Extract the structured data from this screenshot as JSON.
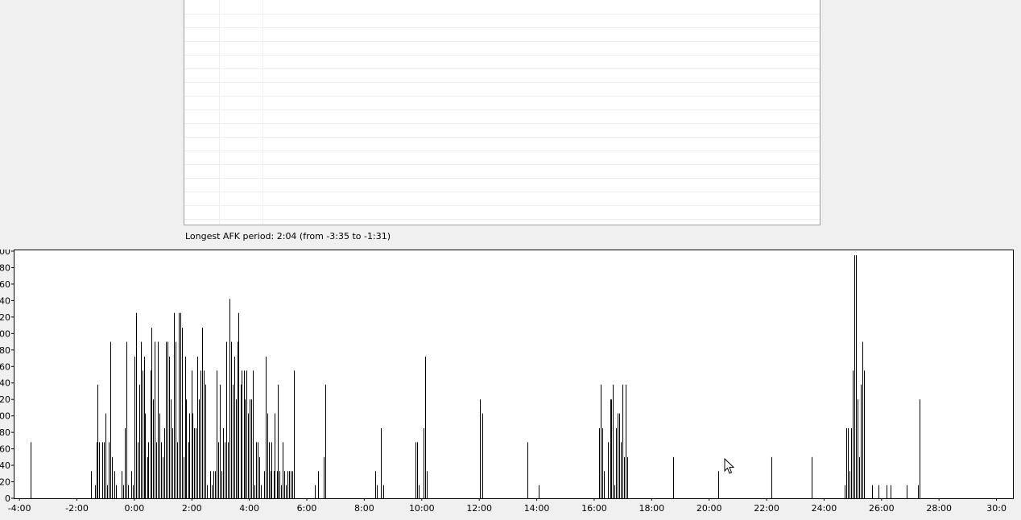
{
  "afk": {
    "label": "Longest AFK period: 2:04 (from -3:35 to -1:31)"
  },
  "colors": {
    "panel_bg": "#ffffff",
    "panel_border": "#a0a0a0",
    "grid": "#eeeeee",
    "bar": "#000000"
  },
  "chart_data": {
    "type": "bar",
    "title": "",
    "xlabel": "",
    "ylabel": "",
    "x_unit": "minutes",
    "x_range": [
      -4.2,
      30.6
    ],
    "ylim": [
      0,
      300
    ],
    "y_ticks": [
      0,
      20,
      40,
      60,
      80,
      100,
      120,
      140,
      160,
      180,
      200,
      220,
      240,
      260,
      280,
      300
    ],
    "y_tick_labels": [
      "0",
      "20",
      "40",
      "60",
      "80",
      "00",
      "20",
      "40",
      "60",
      "80",
      "00",
      "20",
      "40",
      "60",
      "80",
      "00"
    ],
    "x_ticks": [
      -4,
      -2,
      0,
      2,
      4,
      6,
      8,
      10,
      12,
      14,
      16,
      18,
      20,
      22,
      24,
      26,
      28,
      30
    ],
    "x_tick_labels": [
      "-4:00",
      "-2:00",
      "0:00",
      "2:00",
      "4:00",
      "6:00",
      "8:00",
      "10:00",
      "12:00",
      "14:00",
      "16:00",
      "18:00",
      "20:00",
      "22:00",
      "24:00",
      "26:00",
      "28:00",
      "30:0"
    ],
    "grid": false,
    "series": [
      {
        "points": [
          [
            -3.62,
            68
          ],
          [
            -1.5,
            33
          ],
          [
            -1.38,
            16
          ],
          [
            -1.31,
            68
          ],
          [
            -1.28,
            138
          ],
          [
            -1.22,
            68
          ],
          [
            -1.11,
            68
          ],
          [
            -1.06,
            68
          ],
          [
            -1.0,
            103
          ],
          [
            -0.94,
            16
          ],
          [
            -0.89,
            68
          ],
          [
            -0.83,
            190
          ],
          [
            -0.77,
            50
          ],
          [
            -0.7,
            33
          ],
          [
            -0.64,
            16
          ],
          [
            -0.44,
            33
          ],
          [
            -0.38,
            16
          ],
          [
            -0.33,
            85
          ],
          [
            -0.28,
            190
          ],
          [
            -0.22,
            16
          ],
          [
            -0.11,
            33
          ],
          [
            -0.06,
            16
          ],
          [
            0.0,
            172
          ],
          [
            0.06,
            225
          ],
          [
            0.11,
            68
          ],
          [
            0.16,
            138
          ],
          [
            0.22,
            190
          ],
          [
            0.27,
            155
          ],
          [
            0.33,
            172
          ],
          [
            0.38,
            103
          ],
          [
            0.44,
            50
          ],
          [
            0.49,
            68
          ],
          [
            0.55,
            155
          ],
          [
            0.6,
            207
          ],
          [
            0.66,
            120
          ],
          [
            0.71,
            190
          ],
          [
            0.77,
            68
          ],
          [
            0.82,
            190
          ],
          [
            0.88,
            103
          ],
          [
            0.93,
            68
          ],
          [
            0.99,
            50
          ],
          [
            1.04,
            85
          ],
          [
            1.1,
            190
          ],
          [
            1.15,
            190
          ],
          [
            1.21,
            172
          ],
          [
            1.26,
            120
          ],
          [
            1.32,
            85
          ],
          [
            1.37,
            225
          ],
          [
            1.43,
            190
          ],
          [
            1.48,
            68
          ],
          [
            1.54,
            225
          ],
          [
            1.59,
            225
          ],
          [
            1.65,
            207
          ],
          [
            1.7,
            50
          ],
          [
            1.76,
            172
          ],
          [
            1.81,
            120
          ],
          [
            1.87,
            68
          ],
          [
            1.92,
            103
          ],
          [
            1.98,
            155
          ],
          [
            2.03,
            103
          ],
          [
            2.09,
            85
          ],
          [
            2.14,
            85
          ],
          [
            2.2,
            172
          ],
          [
            2.25,
            120
          ],
          [
            2.31,
            155
          ],
          [
            2.36,
            207
          ],
          [
            2.42,
            155
          ],
          [
            2.47,
            138
          ],
          [
            2.53,
            16
          ],
          [
            2.64,
            33
          ],
          [
            2.7,
            16
          ],
          [
            2.75,
            33
          ],
          [
            2.81,
            33
          ],
          [
            2.86,
            155
          ],
          [
            2.92,
            68
          ],
          [
            2.97,
            138
          ],
          [
            3.03,
            33
          ],
          [
            3.08,
            85
          ],
          [
            3.14,
            68
          ],
          [
            3.19,
            190
          ],
          [
            3.25,
            68
          ],
          [
            3.3,
            242
          ],
          [
            3.36,
            190
          ],
          [
            3.41,
            138
          ],
          [
            3.47,
            172
          ],
          [
            3.52,
            120
          ],
          [
            3.58,
            190
          ],
          [
            3.63,
            225
          ],
          [
            3.69,
            138
          ],
          [
            3.74,
            155
          ],
          [
            3.8,
            155
          ],
          [
            3.85,
            120
          ],
          [
            3.91,
            155
          ],
          [
            3.96,
            103
          ],
          [
            4.02,
            120
          ],
          [
            4.07,
            120
          ],
          [
            4.13,
            155
          ],
          [
            4.18,
            16
          ],
          [
            4.24,
            68
          ],
          [
            4.29,
            68
          ],
          [
            4.35,
            50
          ],
          [
            4.4,
            16
          ],
          [
            4.51,
            33
          ],
          [
            4.56,
            172
          ],
          [
            4.62,
            103
          ],
          [
            4.67,
            68
          ],
          [
            4.73,
            33
          ],
          [
            4.78,
            68
          ],
          [
            4.84,
            33
          ],
          [
            4.89,
            103
          ],
          [
            4.95,
            33
          ],
          [
            5.0,
            138
          ],
          [
            5.06,
            33
          ],
          [
            5.11,
            16
          ],
          [
            5.17,
            68
          ],
          [
            5.22,
            33
          ],
          [
            5.28,
            16
          ],
          [
            5.33,
            33
          ],
          [
            5.39,
            33
          ],
          [
            5.44,
            33
          ],
          [
            5.5,
            33
          ],
          [
            5.55,
            155
          ],
          [
            6.27,
            16
          ],
          [
            6.38,
            33
          ],
          [
            6.58,
            50
          ],
          [
            6.64,
            138
          ],
          [
            8.39,
            33
          ],
          [
            8.45,
            16
          ],
          [
            8.58,
            85
          ],
          [
            8.66,
            16
          ],
          [
            9.79,
            68
          ],
          [
            9.84,
            68
          ],
          [
            9.9,
            16
          ],
          [
            10.05,
            85
          ],
          [
            10.11,
            172
          ],
          [
            10.16,
            33
          ],
          [
            12.02,
            120
          ],
          [
            12.12,
            103
          ],
          [
            13.68,
            68
          ],
          [
            14.08,
            16
          ],
          [
            16.18,
            85
          ],
          [
            16.24,
            138
          ],
          [
            16.29,
            85
          ],
          [
            16.34,
            33
          ],
          [
            16.49,
            68
          ],
          [
            16.55,
            120
          ],
          [
            16.6,
            120
          ],
          [
            16.66,
            138
          ],
          [
            16.71,
            16
          ],
          [
            16.77,
            85
          ],
          [
            16.82,
            103
          ],
          [
            16.88,
            103
          ],
          [
            16.93,
            68
          ],
          [
            16.99,
            138
          ],
          [
            17.04,
            50
          ],
          [
            17.1,
            138
          ],
          [
            17.15,
            50
          ],
          [
            18.74,
            50
          ],
          [
            20.32,
            33
          ],
          [
            22.16,
            50
          ],
          [
            23.56,
            50
          ],
          [
            24.72,
            16
          ],
          [
            24.77,
            85
          ],
          [
            24.83,
            85
          ],
          [
            24.88,
            33
          ],
          [
            24.94,
            85
          ],
          [
            24.99,
            155
          ],
          [
            25.05,
            295
          ],
          [
            25.1,
            295
          ],
          [
            25.16,
            120
          ],
          [
            25.21,
            50
          ],
          [
            25.27,
            138
          ],
          [
            25.32,
            190
          ],
          [
            25.38,
            155
          ],
          [
            25.68,
            16
          ],
          [
            25.88,
            16
          ],
          [
            26.18,
            16
          ],
          [
            26.32,
            16
          ],
          [
            26.88,
            16
          ],
          [
            27.27,
            16
          ],
          [
            27.32,
            120
          ]
        ]
      }
    ]
  }
}
